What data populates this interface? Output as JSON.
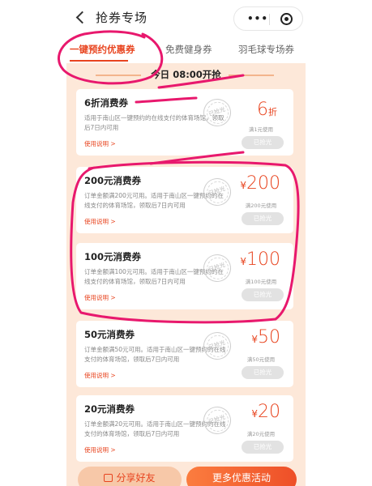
{
  "header": {
    "title": "抢券专场",
    "back_icon": "chevron-left-icon",
    "menu_icon": "more-dots-icon",
    "close_icon": "target-circle-icon",
    "more_label": "•••"
  },
  "tabs": [
    {
      "label": "一键预约优惠券",
      "active": true
    },
    {
      "label": "免费健身券",
      "active": false
    },
    {
      "label": "羽毛球专场券",
      "active": false
    }
  ],
  "start_time": "今日 08:00开抢",
  "cards": [
    {
      "name": "6折消费券",
      "desc": "适用于南山区一键预约的在线支付的体育场馆，领取后7日内可用",
      "rules": "使用说明 >",
      "currency": "",
      "value": "6",
      "suffix": "折",
      "threshold": "满1元使用",
      "stamp": "已抢光",
      "status": "已抢光"
    },
    {
      "name": "200元消费券",
      "desc": "订单金额满200元可用。适用于南山区一键预约的在线支付的体育场馆，领取后7日内可用",
      "rules": "使用说明 >",
      "currency": "¥",
      "value": "200",
      "suffix": "",
      "threshold": "满200元使用",
      "stamp": "已抢光",
      "status": "已抢光"
    },
    {
      "name": "100元消费券",
      "desc": "订单金额满100元可用。适用于南山区一键预约的在线支付的体育场馆，领取后7日内可用",
      "rules": "使用说明 >",
      "currency": "¥",
      "value": "100",
      "suffix": "",
      "threshold": "满100元使用",
      "stamp": "已抢光",
      "status": "已抢光"
    },
    {
      "name": "50元消费券",
      "desc": "订单金额满50元可用。适用于南山区一键预约的在线支付的体育场馆，领取后7日内可用",
      "rules": "使用说明 >",
      "currency": "¥",
      "value": "50",
      "suffix": "",
      "threshold": "满50元使用",
      "stamp": "已抢光",
      "status": "已抢光"
    },
    {
      "name": "20元消费券",
      "desc": "订单金额满20元可用。适用于南山区一键预约的在线支付的体育场馆，领取后7日内可用",
      "rules": "使用说明 >",
      "currency": "¥",
      "value": "20",
      "suffix": "",
      "threshold": "满20元使用",
      "stamp": "已抢光",
      "status": "已抢光"
    }
  ],
  "footer": {
    "share_label": "分享好友",
    "share_icon": "share-icon",
    "more_label": "更多优惠活动"
  },
  "colors": {
    "accent": "#e8441f",
    "page_bg": "#fde8d9",
    "annotation": "#e8186d"
  }
}
